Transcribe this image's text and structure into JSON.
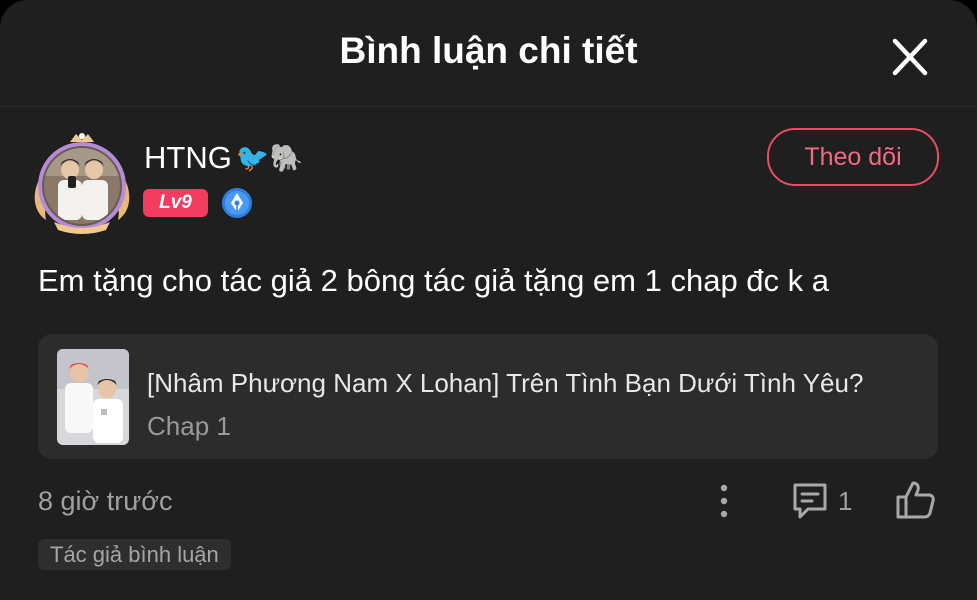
{
  "header": {
    "title": "Bình luận chi tiết",
    "close_icon": "close-icon"
  },
  "user": {
    "name": "HTNG",
    "name_emojis": "🐦🐘",
    "level": "Lv9",
    "badge_icon": "pen-nib-icon",
    "avatar": "avatar-with-gold-frame"
  },
  "follow_button": {
    "label": "Theo dõi"
  },
  "comment": {
    "text": "Em tặng cho tác giả 2 bông tác giả tặng em 1 chap đc k a"
  },
  "story": {
    "title": "[Nhâm Phương Nam X Lohan] Trên Tình Bạn Dưới Tình Yêu?",
    "chapter": "Chap 1",
    "thumbnail": "story-cover"
  },
  "footer": {
    "timestamp": "8 giờ trước",
    "reply_count": "1",
    "author_tag": "Tác giả bình luận"
  },
  "colors": {
    "background": "#1f1f1f",
    "card": "#2c2c2c",
    "accent": "#f03c5f",
    "follow_border": "#e84a68",
    "badge_blue": "#2f7fe0"
  }
}
